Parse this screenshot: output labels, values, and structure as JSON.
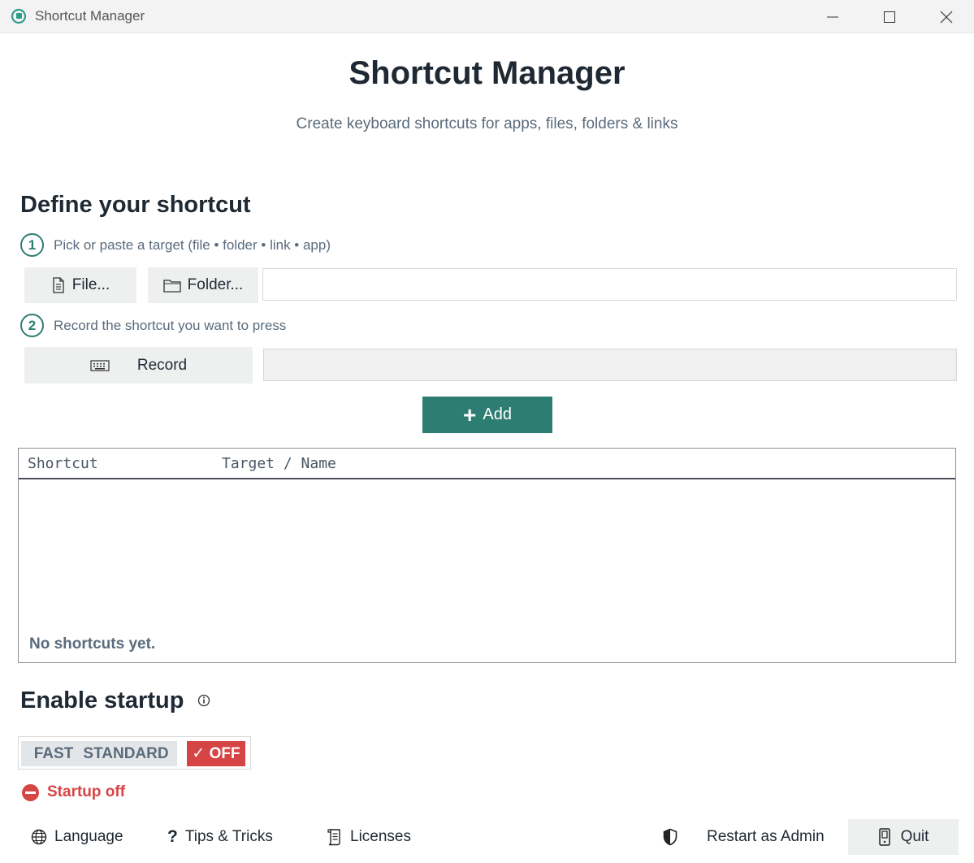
{
  "window": {
    "title": "Shortcut Manager"
  },
  "header": {
    "title": "Shortcut Manager",
    "subtitle": "Create keyboard shortcuts for apps, files, folders & links"
  },
  "define": {
    "title": "Define your shortcut",
    "step1": {
      "num": "1",
      "text": "Pick or paste a target (file • folder • link • app)"
    },
    "file_label": "File...",
    "folder_label": "Folder...",
    "target_value": "",
    "step2": {
      "num": "2",
      "text": "Record the shortcut you want to press"
    },
    "record_label": "Record",
    "shortcut_value": "",
    "add_label": "Add"
  },
  "table": {
    "columns": [
      "Shortcut",
      "Target / Name"
    ],
    "empty_text": "No shortcuts yet."
  },
  "startup": {
    "title": "Enable startup",
    "options": [
      "FAST",
      "STANDARD",
      "OFF"
    ],
    "selected_label": "✓ OFF",
    "status_text": "Startup off"
  },
  "footer": {
    "language": "Language",
    "tips": "Tips & Tricks",
    "licenses": "Licenses",
    "restart_admin": "Restart as Admin",
    "quit": "Quit"
  },
  "colors": {
    "accent": "#2e7d72",
    "danger": "#d64545",
    "muted": "#5a6b7c"
  }
}
